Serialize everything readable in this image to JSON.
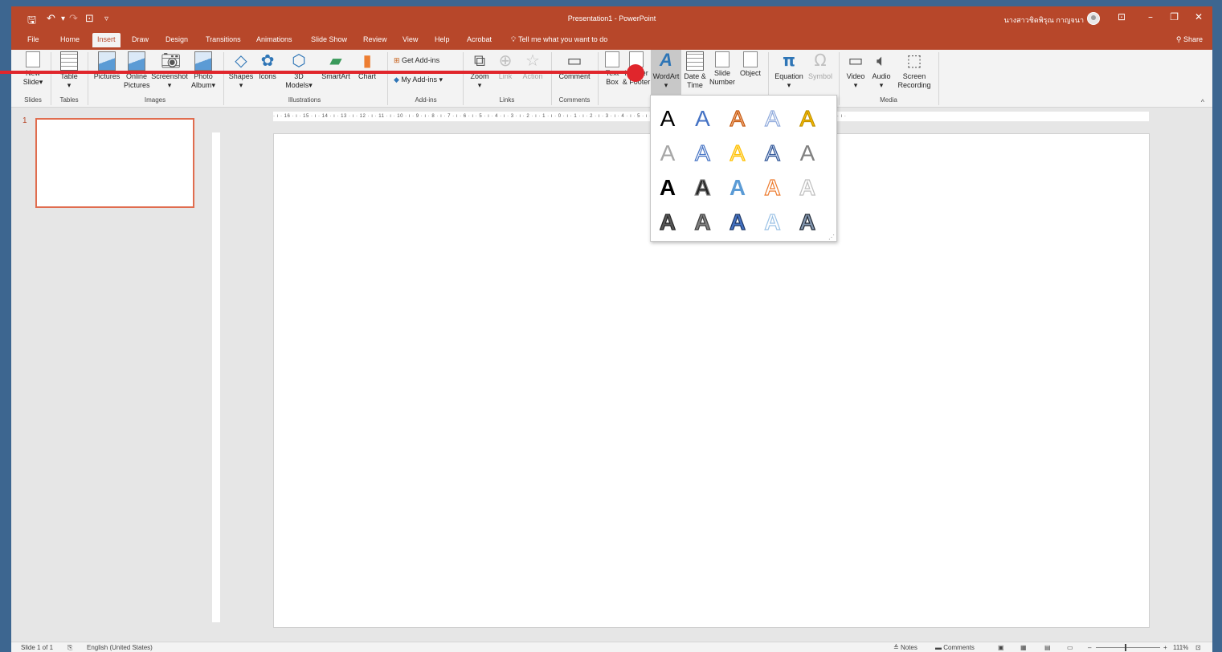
{
  "window": {
    "title": "Presentation1 - PowerPoint",
    "user": "นางสาวชิดพิรุณ กาญจนา",
    "qat_icons": [
      "save-icon",
      "undo-icon",
      "redo-icon",
      "customize-qat-icon"
    ],
    "window_controls": [
      "ribbon-display-options-icon",
      "minimize-icon",
      "restore-icon",
      "close-icon"
    ]
  },
  "tabs": [
    "File",
    "Home",
    "Insert",
    "Draw",
    "Design",
    "Transitions",
    "Animations",
    "Slide Show",
    "Review",
    "View",
    "Help",
    "Acrobat"
  ],
  "active_tab": "Insert",
  "tellme": "Tell me what you want to do",
  "share": "Share",
  "ribbon": {
    "slides": {
      "new_slide": "New",
      "new_slide2": "Slide",
      "group": "Slides"
    },
    "tables": {
      "table": "Table",
      "group": "Tables"
    },
    "images": {
      "pictures": "Pictures",
      "online": "Online",
      "online2": "Pictures",
      "screenshot": "Screenshot",
      "photo": "Photo",
      "photo2": "Album",
      "group": "Images"
    },
    "illustrations": {
      "shapes": "Shapes",
      "icons": "Icons",
      "models": "3D",
      "models2": "Models",
      "smartart": "SmartArt",
      "chart": "Chart",
      "group": "Illustrations"
    },
    "addins": {
      "get": "Get Add-ins",
      "my": "My Add-ins",
      "group": "Add-ins"
    },
    "links": {
      "zoom": "Zoom",
      "link": "Link",
      "action": "Action",
      "group": "Links"
    },
    "comments": {
      "comment": "Comment",
      "group": "Comments"
    },
    "text": {
      "textbox": "Text",
      "textbox2": "Box",
      "header": "Header",
      "header2": "& Footer",
      "wordart": "WordArt",
      "datetime": "Date &",
      "datetime2": "Time",
      "slidenum": "Slide",
      "slidenum2": "Number",
      "object": "Object"
    },
    "symbols": {
      "equation": "Equation",
      "symbol": "Symbol"
    },
    "media": {
      "video": "Video",
      "audio": "Audio",
      "screen": "Screen",
      "screen2": "Recording",
      "group": "Media"
    }
  },
  "ruler_text": "· ı · 16 · ı · 15 · ı · 14 · ı · 13 · ı · 12 · ı · 11 · ı · 10 · ı · 9 · ı · 8 · ı · 7 · ı · 6 · ı · 5 · ı · 4 · ı · 3 · ı · 2 · ı · 1 · ı · 0 · ı · 1 · ı · 2 · ı · 3 · ı · 4 · ı · 5 · ı · 6 · ı · 7 · ı · 8 · ı · 9 · ı · 10 · ı · 11 · ı · 12 · ı · 13 · ı · 14 · ı · 15 · ı · 16 · ı ·",
  "thumbnail": {
    "number": "1"
  },
  "wordart_glyph": "A",
  "wordart_styles": [
    {
      "fill": "#000000",
      "stroke": "none"
    },
    {
      "fill": "#4472c4",
      "stroke": "none"
    },
    {
      "fill": "#f4b183",
      "stroke": "#c55a11"
    },
    {
      "fill": "#ffffff",
      "stroke": "#8faadc"
    },
    {
      "fill": "#ffc000",
      "stroke": "#bf9000"
    },
    {
      "fill": "#a6a6a6",
      "stroke": "none"
    },
    {
      "fill": "#ffffff",
      "stroke": "#4472c4"
    },
    {
      "fill": "#ffe699",
      "stroke": "#ffc000"
    },
    {
      "fill": "#dae3f3",
      "stroke": "#2f5597"
    },
    {
      "fill": "#808080",
      "stroke": "none"
    },
    {
      "fill": "#000000",
      "stroke": "none"
    },
    {
      "fill": "#262626",
      "stroke": "#7f7f7f"
    },
    {
      "fill": "#5b9bd5",
      "stroke": "none"
    },
    {
      "fill": "#ffffff",
      "stroke": "#ed7d31"
    },
    {
      "fill": "#ffffff",
      "stroke": "#bfbfbf"
    },
    {
      "fill": "#595959",
      "stroke": "#262626"
    },
    {
      "fill": "#7f7f7f",
      "stroke": "#404040"
    },
    {
      "fill": "#4472c4",
      "stroke": "#1f3864"
    },
    {
      "fill": "#ffffff",
      "stroke": "#9dc3e6"
    },
    {
      "fill": "#8497b0",
      "stroke": "#222a35"
    }
  ],
  "status": {
    "slide": "Slide 1 of 1",
    "language": "English (United States)",
    "notes": "Notes",
    "comments": "Comments",
    "zoom": "111%"
  },
  "colors": {
    "accent": "#b7472a",
    "frame": "#3d6690",
    "annotation": "#e0262c"
  }
}
